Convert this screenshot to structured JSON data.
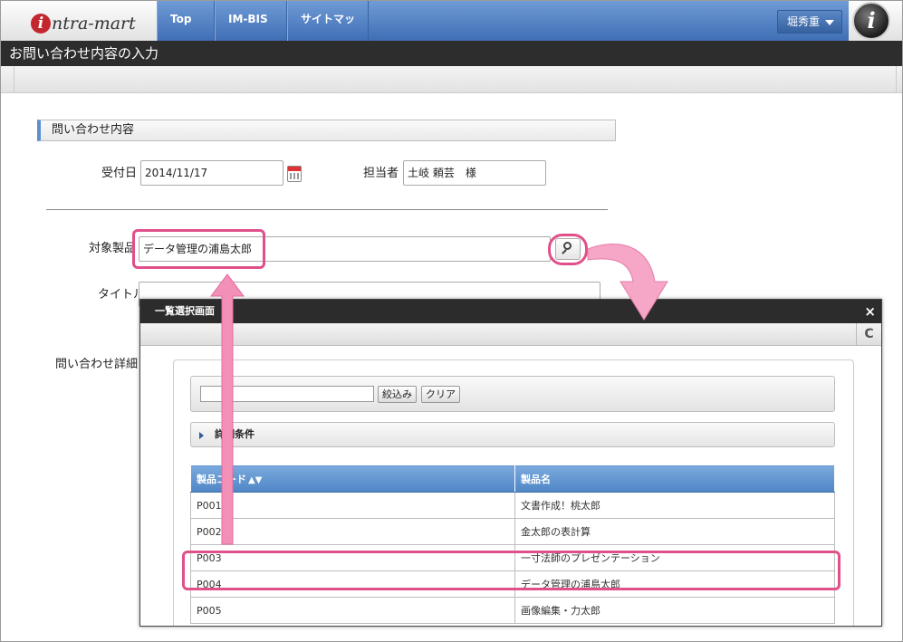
{
  "app": {
    "logo_mark": "i",
    "logo_text": "ntra-mart",
    "nav": [
      {
        "label": "Top"
      },
      {
        "label": "IM-BIS"
      },
      {
        "label": "サイトマップ"
      }
    ],
    "user": "堀秀重",
    "info_icon_glyph": "i"
  },
  "page": {
    "title": "お問い合わせ内容の入力"
  },
  "form": {
    "section_title": "問い合わせ内容",
    "received_date_label": "受付日",
    "received_date_value": "2014/11/17",
    "assignee_label": "担当者",
    "assignee_value": "土岐 頼芸　様",
    "product_label": "対象製品",
    "product_value": "データ管理の浦島太郎",
    "title_label": "タイトル",
    "title_value": "",
    "detail_label": "問い合わせ詳細"
  },
  "modal": {
    "title": "一覧選択画面",
    "close_glyph": "×",
    "refresh_glyph": "C",
    "filter_value": "",
    "filter_button": "絞込み",
    "clear_button": "クリア",
    "conditions_label": "詳細条件",
    "table": {
      "columns": [
        "製品コード",
        "製品名"
      ],
      "sort_glyph": "▲▼",
      "rows": [
        {
          "code": "P001",
          "name": "文書作成！桃太郎"
        },
        {
          "code": "P002",
          "name": "金太郎の表計算"
        },
        {
          "code": "P003",
          "name": "一寸法師のプレゼンテーション"
        },
        {
          "code": "P004",
          "name": "データ管理の浦島太郎"
        },
        {
          "code": "P005",
          "name": "画像編集・力太郎"
        }
      ]
    }
  },
  "colors": {
    "highlight": "#e0508a",
    "arrow": "#f290b8",
    "nav_blue": "#4f7fc0",
    "title_bar": "#2d2d2d"
  }
}
